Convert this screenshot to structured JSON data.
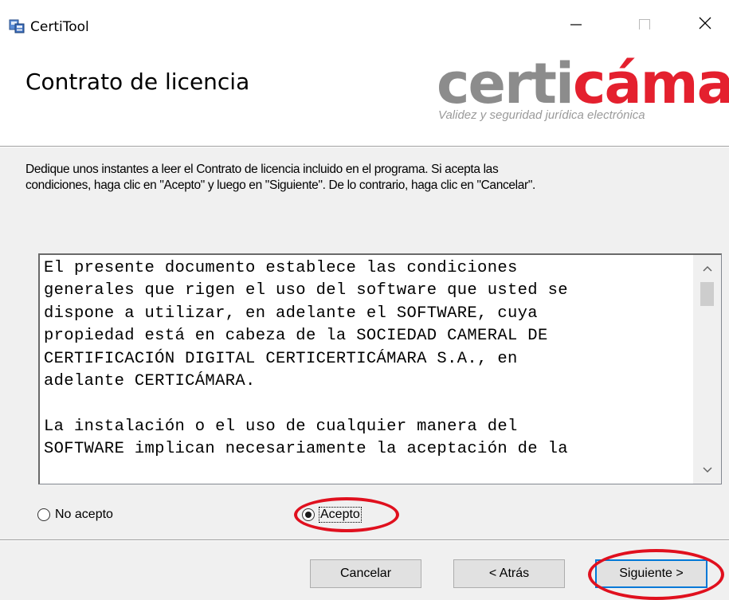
{
  "window": {
    "title": "CertiTool",
    "controls": {
      "minimize": "minimize-icon",
      "maximize": "maximize-icon",
      "close": "close-icon"
    }
  },
  "banner": {
    "title": "Contrato de licencia",
    "logo": {
      "part1": "certi",
      "part2": "cámara.",
      "tagline": "Validez y seguridad jurídica electrónica"
    }
  },
  "instructions": [
    "Dedique unos instantes a leer el Contrato de licencia incluido en el programa. Si acepta las",
    "condiciones, haga clic en \"Acepto\" y luego en \"Siguiente\". De lo contrario, haga clic en \"Cancelar\"."
  ],
  "license": {
    "lines": [
      "El presente documento establece las condiciones",
      "generales que rigen el uso del software que usted se",
      "dispone a utilizar, en adelante el SOFTWARE, cuya",
      "propiedad está en cabeza de la SOCIEDAD CAMERAL DE",
      "CERTIFICACIÓN DIGITAL CERTICERTICÁMARA S.A., en",
      "adelante CERTICÁMARA.",
      "",
      "La instalación o el uso de cualquier manera del",
      "SOFTWARE implican necesariamente la aceptación de la"
    ]
  },
  "radios": {
    "no_accept": {
      "label": "No acepto",
      "selected": false
    },
    "accept": {
      "label": "Acepto",
      "selected": true
    }
  },
  "buttons": {
    "cancel": "Cancelar",
    "back": "< Atrás",
    "next": "Siguiente >"
  },
  "colors": {
    "logo_gray": "#8c8c8c",
    "logo_red": "#e4202e",
    "annotation": "#e0101e",
    "focus_border": "#0078d7"
  }
}
